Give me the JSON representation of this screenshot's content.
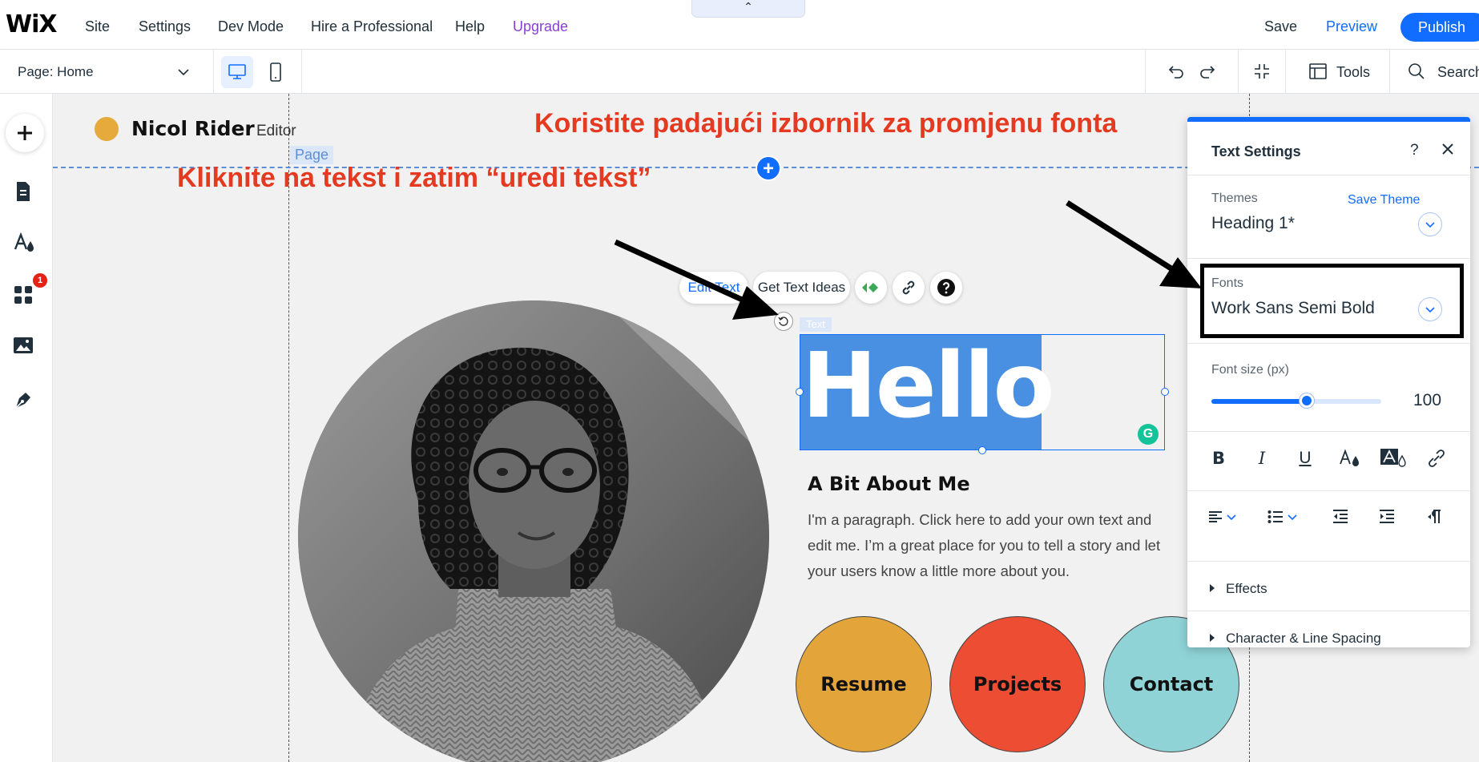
{
  "topbar": {
    "logo": "WiX",
    "menu": [
      "Site",
      "Settings",
      "Dev Mode",
      "Hire a Professional",
      "Help",
      "Upgrade"
    ],
    "collapse_glyph": "⌃",
    "save": "Save",
    "preview": "Preview",
    "publish": "Publish"
  },
  "toolbar": {
    "page_label": "Page:",
    "page_value": "Home",
    "tools": "Tools",
    "search": "Search"
  },
  "leftrail": {
    "apps_badge": "1"
  },
  "canvas": {
    "site_name": "Nicol Rider",
    "site_editor_label": "Editor",
    "page_tag": "Page",
    "annotation_font": "Koristite padajući izbornik za promjenu fonta",
    "annotation_text": "Kliknite na tekst i zatim “uredi tekst”",
    "floating": {
      "edit_text": "Edit Text",
      "get_ideas": "Get Text Ideas"
    },
    "text_tag": "Text",
    "heading": "Hello",
    "about_title": "A Bit About Me",
    "about_paragraph": "I'm a paragraph. Click here to add your own text and edit me. I’m a great place for you to tell a story and let your users know a little more about you.",
    "circle_buttons": [
      {
        "label": "Resume",
        "color": "#e3a53a"
      },
      {
        "label": "Projects",
        "color": "#ec4d33"
      },
      {
        "label": "Contact",
        "color": "#8fd3d7"
      }
    ]
  },
  "panel": {
    "title": "Text Settings",
    "help": "?",
    "themes_label": "Themes",
    "save_theme": "Save Theme",
    "theme_value": "Heading 1*",
    "fonts_label": "Fonts",
    "font_value": "Work Sans Semi Bold",
    "font_size_label": "Font size (px)",
    "font_size_value": "100",
    "font_size_fraction": 0.56,
    "format_labels": {
      "bold": "B",
      "italic": "I",
      "underline": "U"
    },
    "effects": "Effects",
    "spacing": "Character & Line Spacing"
  },
  "colors": {
    "accent": "#116dff",
    "annotation": "#e53a22",
    "upgrade": "#8a3fd1"
  }
}
